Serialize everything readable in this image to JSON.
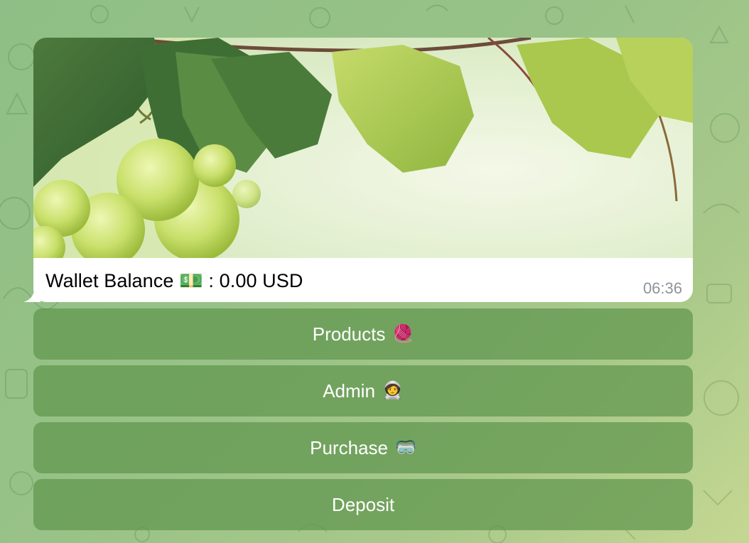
{
  "message": {
    "caption": "Wallet Balance 💵 : 0.00 USD",
    "time": "06:36"
  },
  "keyboard": [
    {
      "label": "Products",
      "emoji": "🧶"
    },
    {
      "label": "Admin",
      "emoji": "🧑‍🚀"
    },
    {
      "label": "Purchase",
      "emoji": "🥽"
    },
    {
      "label": "Deposit",
      "emoji": ""
    }
  ],
  "colors": {
    "chat_background": "#98c287",
    "button_fill": "#60964e",
    "bubble": "#ffffff",
    "timestamp": "#8f949a"
  }
}
